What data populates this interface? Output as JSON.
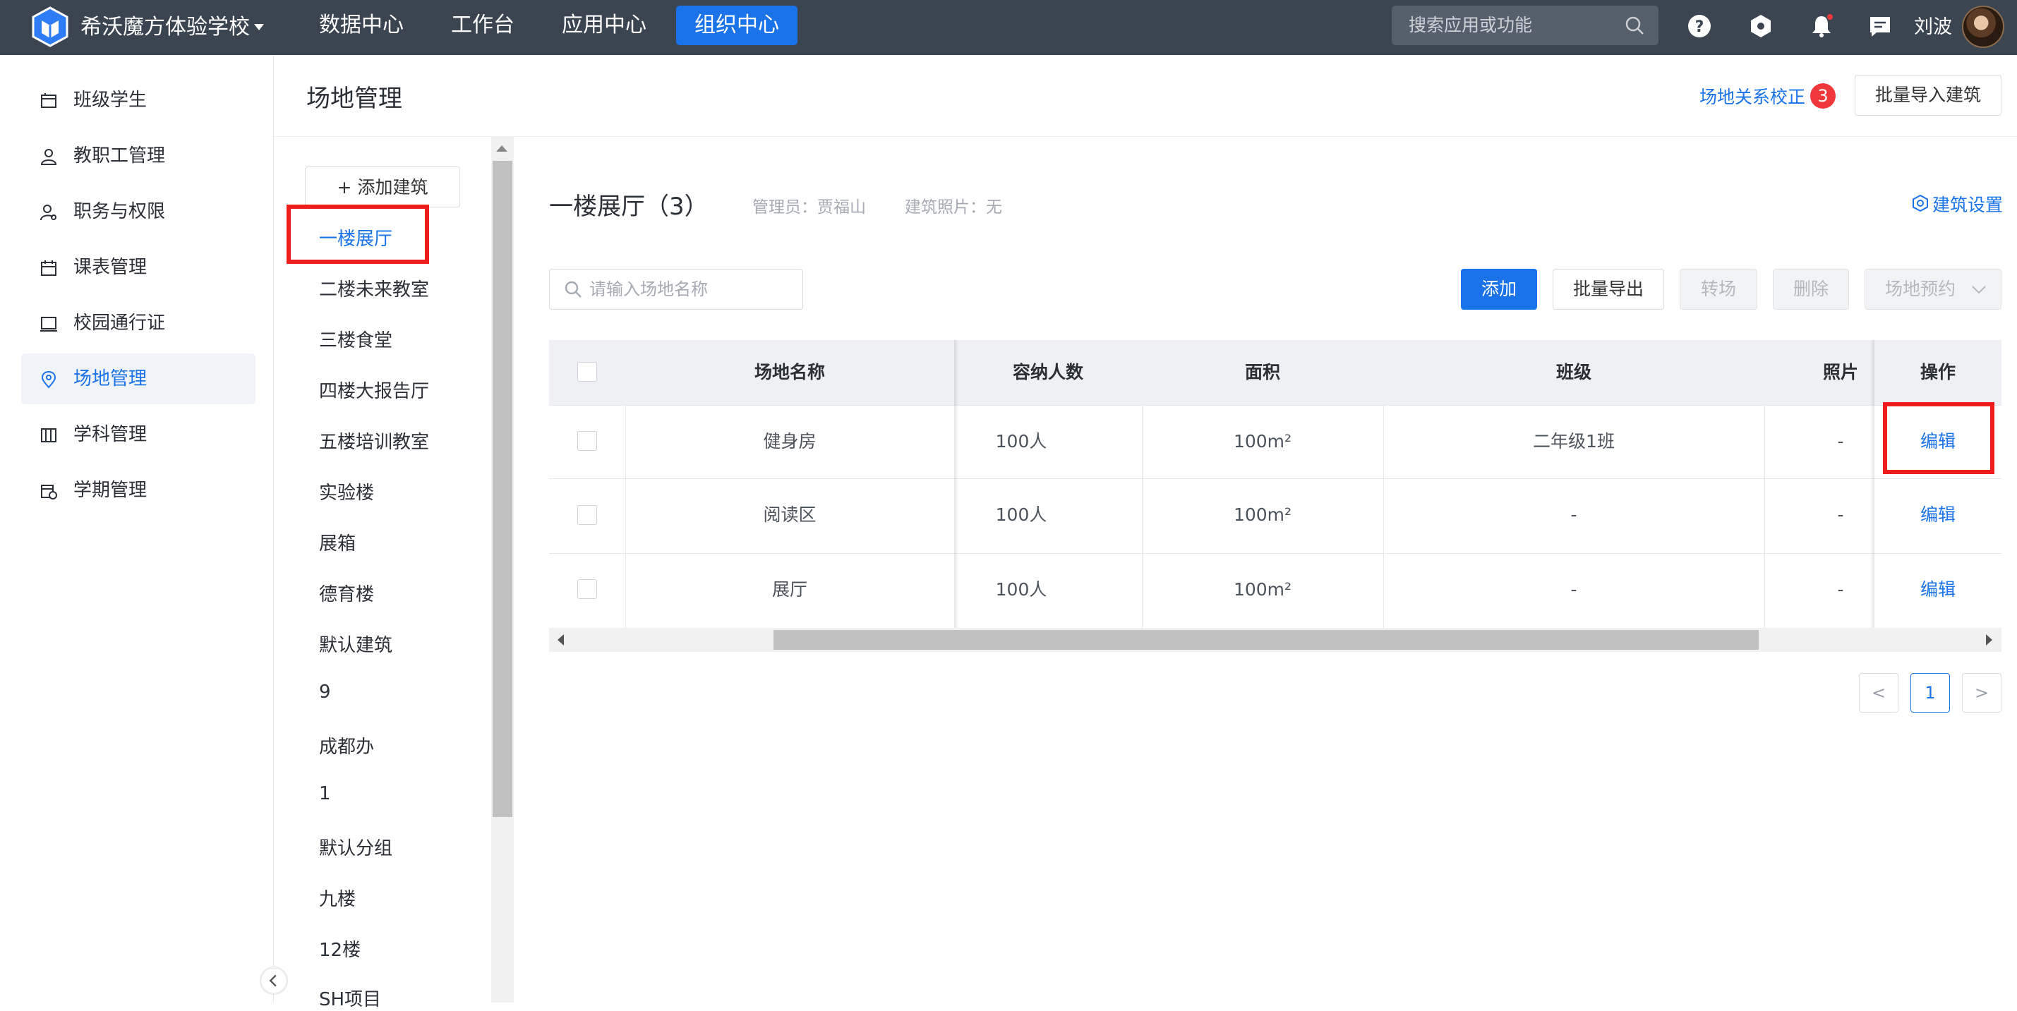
{
  "topbar": {
    "school_name": "希沃魔方体验学校",
    "nav": [
      "数据中心",
      "工作台",
      "应用中心",
      "组织中心"
    ],
    "search_placeholder": "搜索应用或功能",
    "user_name": "刘波",
    "icons": [
      "help-icon",
      "settings-hexagon-icon",
      "bell-icon",
      "message-icon"
    ]
  },
  "sidebar": {
    "items": [
      {
        "label": "班级学生",
        "icon": "class-icon"
      },
      {
        "label": "教职工管理",
        "icon": "person-icon"
      },
      {
        "label": "职务与权限",
        "icon": "role-icon"
      },
      {
        "label": "课表管理",
        "icon": "calendar-icon"
      },
      {
        "label": "校园通行证",
        "icon": "card-icon"
      },
      {
        "label": "场地管理",
        "icon": "location-icon"
      },
      {
        "label": "学科管理",
        "icon": "book-icon"
      },
      {
        "label": "学期管理",
        "icon": "term-calendar-icon"
      }
    ],
    "active_index": 5
  },
  "header": {
    "title": "场地管理",
    "fix_link": "场地关系校正",
    "fix_count": "3",
    "import_btn": "批量导入建筑"
  },
  "buildings": {
    "add_btn": "+ 添加建筑",
    "items": [
      "一楼展厅",
      "二楼未来教室",
      "三楼食堂",
      "四楼大报告厅",
      "五楼培训教室",
      "实验楼",
      "展箱",
      "德育楼",
      "默认建筑",
      "9",
      "成都办",
      "1",
      "默认分组",
      "九楼",
      "12楼",
      "SH项目"
    ],
    "active_index": 0
  },
  "detail": {
    "title": "一楼展厅（3）",
    "admin": "管理员：贾福山",
    "photo": "建筑照片：无",
    "settings": "建筑设置",
    "search_placeholder": "请输入场地名称",
    "buttons": {
      "add": "添加",
      "export": "批量导出",
      "transfer": "转场",
      "delete": "删除",
      "reserve": "场地预约"
    }
  },
  "table": {
    "headers": [
      "场地名称",
      "容纳人数",
      "面积",
      "班级",
      "照片",
      "操作"
    ],
    "rows": [
      {
        "name": "健身房",
        "capacity": "100人",
        "area": "100m²",
        "class": "二年级1班",
        "photo": "-",
        "action": "编辑"
      },
      {
        "name": "阅读区",
        "capacity": "100人",
        "area": "100m²",
        "class": "-",
        "photo": "-",
        "action": "编辑"
      },
      {
        "name": "展厅",
        "capacity": "100人",
        "area": "100m²",
        "class": "-",
        "photo": "-",
        "action": "编辑"
      }
    ]
  },
  "pagination": {
    "prev": "<",
    "current": "1",
    "next": ">"
  },
  "colors": {
    "accent": "#1a73e8",
    "topbar": "#3b4552",
    "highlight_box": "#ee1c1c",
    "badge": "#f0383b"
  }
}
